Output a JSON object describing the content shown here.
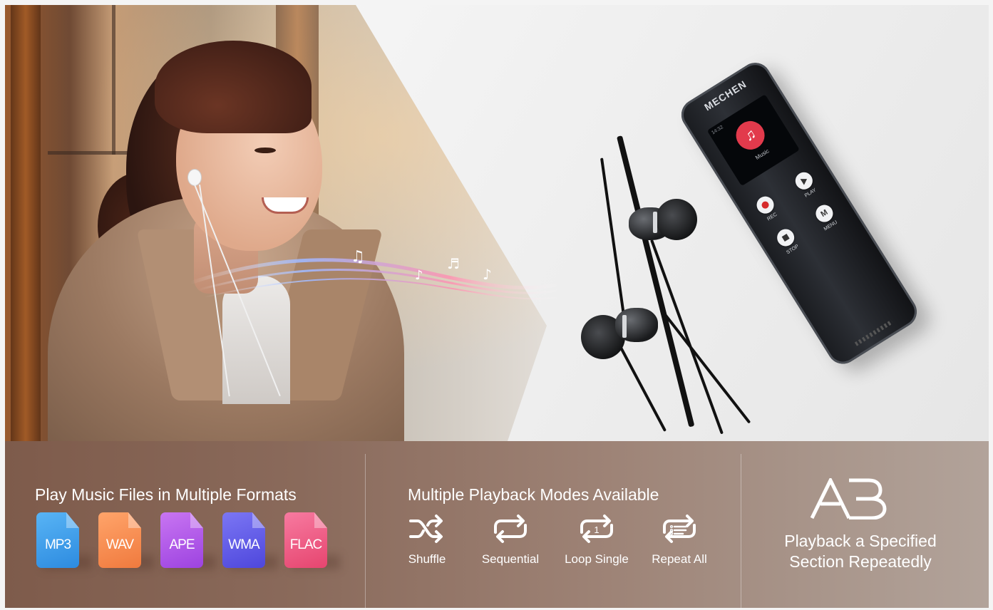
{
  "device": {
    "brand": "MECHEN",
    "screen_time": "14:32",
    "screen_label": "Music",
    "buttons": {
      "rec": "REC",
      "play": "PLAY",
      "stop": "STOP",
      "menu": "MENU",
      "menu_glyph": "M"
    }
  },
  "formats": {
    "title": "Play Music Files in Multiple Formats",
    "items": [
      {
        "label": "MP3",
        "color_a": "#58b4f5",
        "color_b": "#2d8be0"
      },
      {
        "label": "WAV",
        "color_a": "#ffa46a",
        "color_b": "#f07a3e"
      },
      {
        "label": "APE",
        "color_a": "#c875f2",
        "color_b": "#9d43e0"
      },
      {
        "label": "WMA",
        "color_a": "#7b76f4",
        "color_b": "#4e47dc"
      },
      {
        "label": "FLAC",
        "color_a": "#f77aa0",
        "color_b": "#e6456f"
      }
    ]
  },
  "modes": {
    "title": "Multiple Playback Modes Available",
    "items": [
      {
        "label": "Shuffle",
        "icon": "shuffle-icon"
      },
      {
        "label": "Sequential",
        "icon": "sequential-icon"
      },
      {
        "label": "Loop Single",
        "icon": "loop-single-icon"
      },
      {
        "label": "Repeat All",
        "icon": "repeat-all-icon"
      }
    ]
  },
  "ab_repeat": {
    "logo": "AB",
    "line1": "Playback a Specified",
    "line2": "Section Repeatedly"
  }
}
